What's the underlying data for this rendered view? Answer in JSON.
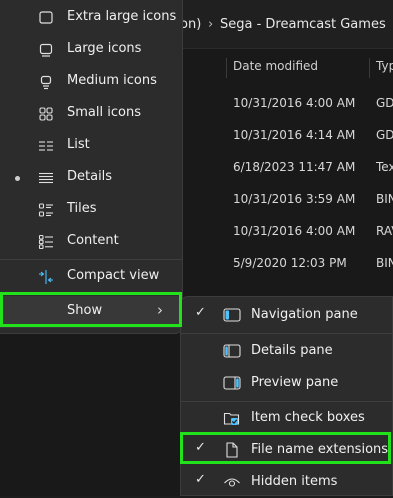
{
  "breadcrumb": {
    "partial": "on)",
    "separator": "›",
    "folder": "Sega - Dreamcast Games"
  },
  "columns": {
    "date_modified": "Date modified",
    "type": "Typ"
  },
  "rows": [
    {
      "date": "10/31/2016 4:00 AM",
      "type": "GD"
    },
    {
      "date": "10/31/2016 4:14 AM",
      "type": "GD"
    },
    {
      "date": "6/18/2023 11:47 AM",
      "type": "Tex"
    },
    {
      "date": "10/31/2016 3:59 AM",
      "type": "BIN"
    },
    {
      "date": "10/31/2016 4:00 AM",
      "type": "RAV"
    },
    {
      "date": "5/9/2020 12:03 PM",
      "type": "BIN"
    }
  ],
  "view_menu": {
    "extra_large_icons": "Extra large icons",
    "large_icons": "Large icons",
    "medium_icons": "Medium icons",
    "small_icons": "Small icons",
    "list": "List",
    "details": "Details",
    "tiles": "Tiles",
    "content": "Content",
    "compact_view": "Compact view",
    "show": "Show",
    "show_arrow": "›"
  },
  "show_menu": {
    "navigation_pane": "Navigation pane",
    "details_pane": "Details pane",
    "preview_pane": "Preview pane",
    "item_check_boxes": "Item check boxes",
    "file_name_extensions": "File name extensions",
    "hidden_items": "Hidden items",
    "check_mark": "✓"
  },
  "colors": {
    "highlight": "#22e31b",
    "checkbox_accent": "#4cc2ff"
  }
}
